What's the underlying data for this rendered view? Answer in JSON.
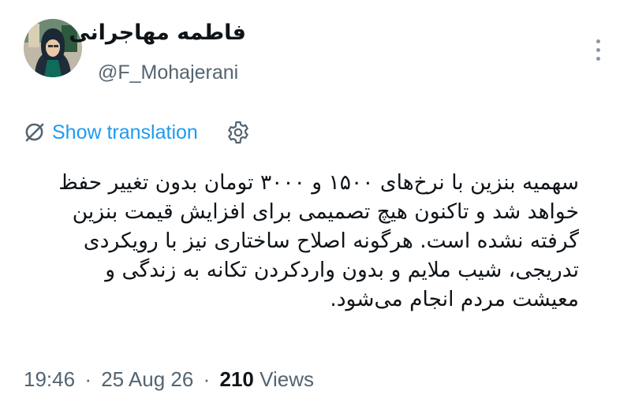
{
  "author": {
    "display_name": "فاطمه مهاجرانی",
    "handle": "@F_Mohajerani",
    "avatar_icon": "profile-photo"
  },
  "translation": {
    "link_label": "Show translation",
    "icon": "translate-slash-icon",
    "settings_icon": "gear-icon"
  },
  "tweet": {
    "lines": [
      "سهمیه بنزین با نرخ‌های ۱۵۰۰ و ۳۰۰۰ تومان بدون تغییر حفظ",
      "خواهد شد و تاکنون هیچ تصمیمی برای افزایش قیمت بنزین",
      "گرفته نشده است. هرگونه اصلاح ساختاری نیز با رویکردی",
      "تدریجی، شیب ملایم و بدون واردکردن تکانه به زندگی و",
      "معیشت مردم انجام می‌شود."
    ]
  },
  "meta": {
    "time": "19:46",
    "separator": "·",
    "date": "25 Aug 26",
    "views_count": "210",
    "views_label": "Views"
  },
  "colors": {
    "link": "#1d9bf0",
    "secondary_text": "#536471",
    "primary_text": "#0f1419"
  }
}
